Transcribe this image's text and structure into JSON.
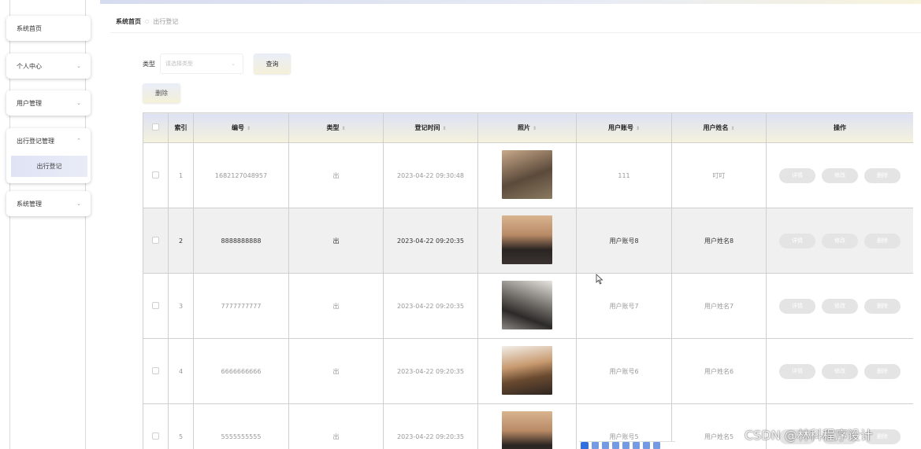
{
  "sidebar": {
    "items": [
      {
        "label": "系统首页"
      },
      {
        "label": "个人中心"
      },
      {
        "label": "用户管理"
      },
      {
        "label": "出行登记管理"
      },
      {
        "label": "系统管理"
      }
    ],
    "active_sub": "出行登记"
  },
  "breadcrumb": {
    "home": "系统首页",
    "current": "出行登记"
  },
  "search": {
    "type_label": "类型",
    "type_placeholder": "请选择类型",
    "query_label": "查询"
  },
  "toolbar": {
    "delete_label": "删除"
  },
  "table": {
    "headers": [
      "索引",
      "编号",
      "类型",
      "登记时间",
      "照片",
      "用户账号",
      "用户姓名",
      "操作"
    ],
    "rows": [
      {
        "index": "1",
        "number": "1682127048957",
        "type": "出",
        "time": "2023-04-22 09:30:48",
        "account": "111",
        "name": "叮叮"
      },
      {
        "index": "2",
        "number": "8888888888",
        "type": "出",
        "time": "2023-04-22 09:20:35",
        "account": "用户账号8",
        "name": "用户姓名8"
      },
      {
        "index": "3",
        "number": "7777777777",
        "type": "出",
        "time": "2023-04-22 09:20:35",
        "account": "用户账号7",
        "name": "用户姓名7"
      },
      {
        "index": "4",
        "number": "6666666666",
        "type": "出",
        "time": "2023-04-22 09:20:35",
        "account": "用户账号6",
        "name": "用户姓名6"
      },
      {
        "index": "5",
        "number": "5555555555",
        "type": "出",
        "time": "2023-04-22 09:20:35",
        "account": "用户账号5",
        "name": "用户姓名5"
      }
    ],
    "actions": {
      "detail": "详情",
      "edit": "修改",
      "delete": "删除"
    },
    "sort_icon": "⇕"
  },
  "watermark": "CSDN @林科程序设计",
  "colors": {
    "accent": "#dde2f4",
    "highlight_row": "#f0f0f0",
    "action_button": "#e4e4e4"
  }
}
